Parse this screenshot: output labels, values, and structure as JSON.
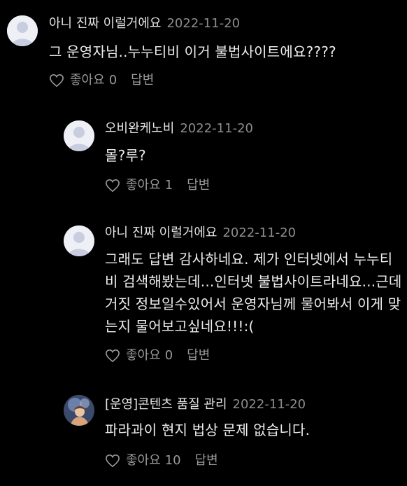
{
  "comments": [
    {
      "author": "아니 진짜 이럴거에요",
      "date": "2022-11-20",
      "text": "그 운영자님..누누티비 이거 불법사이트에요????",
      "like_label": "좋아요",
      "like_count": "0",
      "reply_label": "답변",
      "avatar_icon": "default-user-avatar"
    },
    {
      "author": "오비완케노비",
      "date": "2022-11-20",
      "text": "몰?루?",
      "like_label": "좋아요",
      "like_count": "1",
      "reply_label": "답변",
      "avatar_icon": "default-user-avatar"
    },
    {
      "author": "아니 진짜 이럴거에요",
      "date": "2022-11-20",
      "text": "그래도 답변 감사하네요. 제가 인터넷에서 누누티비 검색해봤는데...인터넷 불법사이트라네요...근데 거짓 정보일수있어서 운영자님께 물어봐서 이게 맞는지 물어보고싶네요!!!:(",
      "like_label": "좋아요",
      "like_count": "0",
      "reply_label": "답변",
      "avatar_icon": "default-user-avatar"
    },
    {
      "author": "[운영]콘텐츠 품질 관리",
      "date": "2022-11-20",
      "text": "파라과이 현지 법상 문제 없습니다.",
      "like_label": "좋아요",
      "like_count": "10",
      "reply_label": "답변",
      "avatar_icon": "operator-profile-avatar"
    }
  ],
  "colors": {
    "background": "#000000",
    "author": "#e4e4e4",
    "date": "#8d8d8d",
    "body": "#ededed",
    "actions": "#9a9a9a"
  }
}
